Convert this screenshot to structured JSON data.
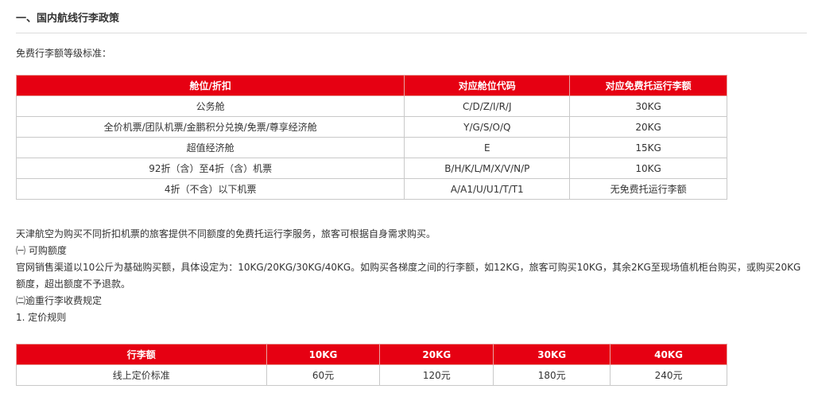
{
  "section": {
    "title": "一、国内航线行李政策"
  },
  "intro": "免费行李额等级标准：",
  "table1": {
    "headers": [
      "舱位/折扣",
      "对应舱位代码",
      "对应免费托运行李额"
    ],
    "rows": [
      [
        "公务舱",
        "C/D/Z/I/R/J",
        "30KG"
      ],
      [
        "全价机票/团队机票/金鹏积分兑换/免票/尊享经济舱",
        "Y/G/S/O/Q",
        "20KG"
      ],
      [
        "超值经济舱",
        "E",
        "15KG"
      ],
      [
        "92折（含）至4折（含）机票",
        "B/H/K/L/M/X/V/N/P",
        "10KG"
      ],
      [
        "4折（不含）以下机票",
        "A/A1/U/U1/T/T1",
        "无免费托运行李额"
      ]
    ]
  },
  "paragraphs": {
    "p1": "天津航空为购买不同折扣机票的旅客提供不同额度的免费托运行李服务，旅客可根据自身需求购买。",
    "p2": "㈠ 可购额度",
    "p3": "官网销售渠道以10公斤为基础购买额，具体设定为：10KG/20KG/30KG/40KG。如购买各梯度之间的行李额，如12KG，旅客可购买10KG，其余2KG至现场值机柜台购买，或购买20KG额度，超出额度不予退款。",
    "p4": "㈡逾重行李收费规定",
    "p5": "1. 定价规则"
  },
  "table2": {
    "headers": [
      "行李额",
      "10KG",
      "20KG",
      "30KG",
      "40KG"
    ],
    "rows": [
      [
        "线上定价标准",
        "60元",
        "120元",
        "180元",
        "240元"
      ]
    ]
  },
  "colors": {
    "header_bg": "#e60012",
    "header_text": "#ffffff",
    "body_text": "#333333"
  }
}
